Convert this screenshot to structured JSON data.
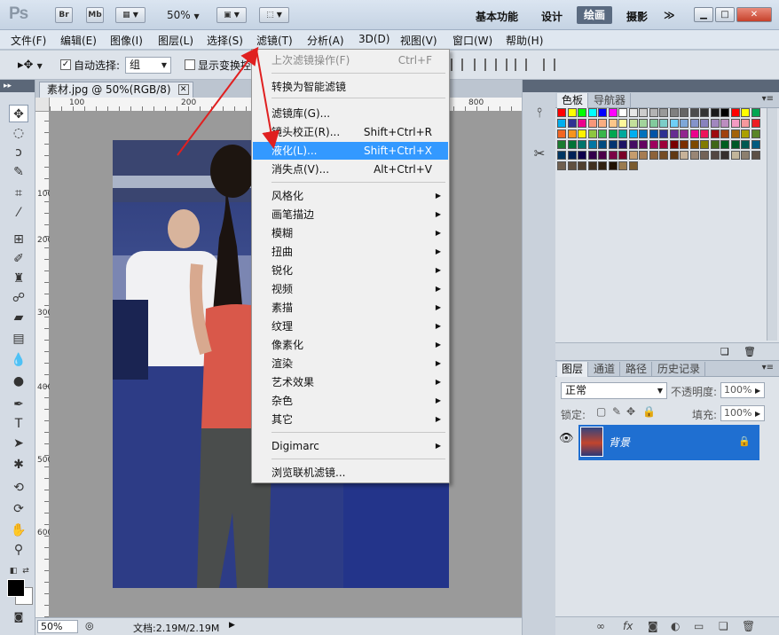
{
  "titlebar": {
    "app_logo": "Ps",
    "btn_br": "Br",
    "btn_mb": "Mb",
    "zoom": "50%",
    "workspaces": [
      "基本功能",
      "设计",
      "绘画",
      "摄影"
    ],
    "more": "≫"
  },
  "menubar": [
    "文件(F)",
    "编辑(E)",
    "图像(I)",
    "图层(L)",
    "选择(S)",
    "滤镜(T)",
    "分析(A)",
    "3D(D)",
    "视图(V)",
    "窗口(W)",
    "帮助(H)"
  ],
  "options": {
    "auto_select_label": "自动选择:",
    "auto_select_value": "组",
    "show_transform_label": "显示变换控"
  },
  "document": {
    "tab_title": "素材.jpg @ 50%(RGB/8)",
    "ruler_top": [
      "100",
      "200",
      "800"
    ],
    "ruler_left": [
      "100",
      "200",
      "300",
      "400",
      "500",
      "600"
    ],
    "status_zoom": "50%",
    "status_doc": "文档:2.19M/2.19M"
  },
  "filter_menu": [
    {
      "label": "上次滤镜操作(F)",
      "shortcut": "Ctrl+F",
      "disabled": true
    },
    {
      "label": "转换为智能滤镜"
    },
    {
      "label": "滤镜库(G)..."
    },
    {
      "label": "镜头校正(R)...",
      "shortcut": "Shift+Ctrl+R"
    },
    {
      "label": "液化(L)...",
      "shortcut": "Shift+Ctrl+X",
      "highlighted": true
    },
    {
      "label": "消失点(V)...",
      "shortcut": "Alt+Ctrl+V"
    },
    {
      "label": "风格化",
      "submenu": true
    },
    {
      "label": "画笔描边",
      "submenu": true
    },
    {
      "label": "模糊",
      "submenu": true
    },
    {
      "label": "扭曲",
      "submenu": true
    },
    {
      "label": "锐化",
      "submenu": true
    },
    {
      "label": "视频",
      "submenu": true
    },
    {
      "label": "素描",
      "submenu": true
    },
    {
      "label": "纹理",
      "submenu": true
    },
    {
      "label": "像素化",
      "submenu": true
    },
    {
      "label": "渲染",
      "submenu": true
    },
    {
      "label": "艺术效果",
      "submenu": true
    },
    {
      "label": "杂色",
      "submenu": true
    },
    {
      "label": "其它",
      "submenu": true
    },
    {
      "label": "Digimarc",
      "submenu": true
    },
    {
      "label": "浏览联机滤镜..."
    }
  ],
  "swatch_panel": {
    "tabs": [
      "色板",
      "导航器"
    ]
  },
  "layers_panel": {
    "tabs": [
      "图层",
      "通道",
      "路径",
      "历史记录"
    ],
    "blend_mode": "正常",
    "opacity_label": "不透明度:",
    "opacity_value": "100%",
    "lock_label": "锁定:",
    "fill_label": "填充:",
    "fill_value": "100%",
    "layer_name": "背景"
  },
  "colors": {
    "menu_highlight": "#3399ff",
    "layer_selected": "#1f6fd1",
    "arrow": "#e02020"
  }
}
